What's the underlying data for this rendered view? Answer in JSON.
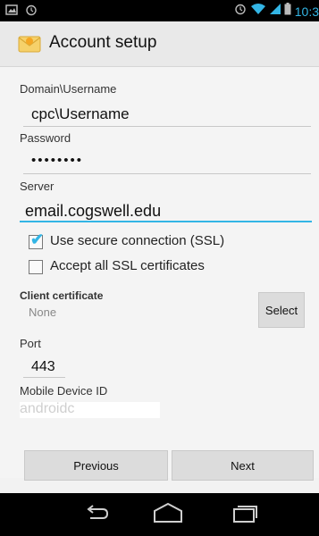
{
  "status": {
    "time": "10:3"
  },
  "app": {
    "title": "Account setup"
  },
  "form": {
    "domain_label": "Domain\\Username",
    "domain_value": "cpc\\Username",
    "password_label": "Password",
    "password_value": "••••••••",
    "server_label": "Server",
    "server_value": "email.cogswell.edu",
    "ssl_label": "Use secure connection (SSL)",
    "ssl_checked": true,
    "accept_label": "Accept all SSL certificates",
    "accept_checked": false,
    "client_cert_label": "Client certificate",
    "client_cert_value": "None",
    "select_button": "Select",
    "port_label": "Port",
    "port_value": "443",
    "device_id_label": "Mobile Device ID",
    "device_id_value": "androidc"
  },
  "buttons": {
    "previous": "Previous",
    "next": "Next"
  },
  "icons": [
    "screenshot-icon",
    "alarm-icon",
    "wifi-icon",
    "signal-icon",
    "battery-icon",
    "back-icon",
    "home-icon",
    "recents-icon"
  ],
  "colors": {
    "accent": "#33b5e5",
    "background": "#f4f4f4",
    "statusbar": "#000000"
  }
}
